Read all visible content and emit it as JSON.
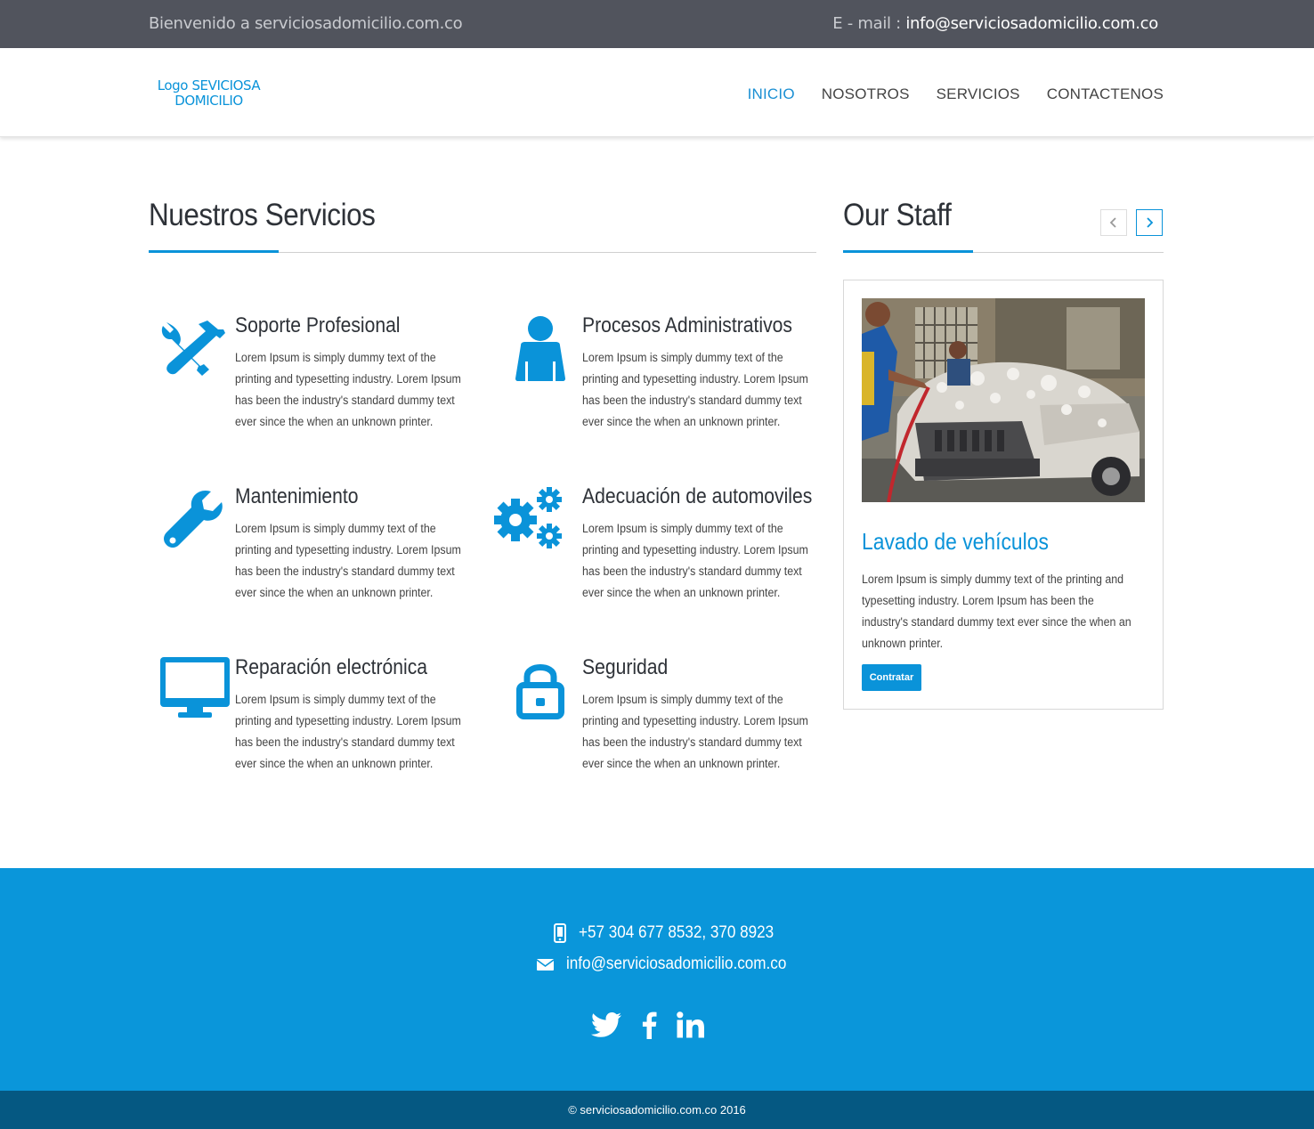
{
  "topbar": {
    "welcome": "Bienvenido a serviciosadomicilio.com.co",
    "email_label": "E - mail : ",
    "email": "info@serviciosadomicilio.com.co"
  },
  "header": {
    "logo_line1": "Logo SEVICIOSA",
    "logo_line2": "DOMICILIO",
    "nav": [
      "INICIO",
      "NOSOTROS",
      "SERVICIOS",
      "CONTACTENOS"
    ],
    "active_nav": "INICIO"
  },
  "services": {
    "title": "Nuestros Servicios",
    "items": [
      {
        "title": "Soporte Profesional",
        "icon": "tools-icon",
        "text": "Lorem Ipsum is simply dummy text of the printing and typesetting industry. Lorem Ipsum has been the industry's standard dummy text ever since the when an unknown printer."
      },
      {
        "title": "Procesos Administrativos",
        "icon": "user-icon",
        "text": "Lorem Ipsum is simply dummy text of the printing and typesetting industry. Lorem Ipsum has been the industry's standard dummy text ever since the when an unknown printer."
      },
      {
        "title": "Mantenimiento",
        "icon": "wrench-icon",
        "text": "Lorem Ipsum is simply dummy text of the printing and typesetting industry. Lorem Ipsum has been the industry's standard dummy text ever since the when an unknown printer."
      },
      {
        "title": "Adecuación de automoviles",
        "icon": "gears-icon",
        "text": "Lorem Ipsum is simply dummy text of the printing and typesetting industry. Lorem Ipsum has been the industry's standard dummy text ever since the when an unknown printer."
      },
      {
        "title": "Reparación electrónica",
        "icon": "monitor-icon",
        "text": "Lorem Ipsum is simply dummy text of the printing and typesetting industry. Lorem Ipsum has been the industry's standard dummy text ever since the when an unknown printer."
      },
      {
        "title": "Seguridad",
        "icon": "lock-icon",
        "text": "Lorem Ipsum is simply dummy text of the printing and typesetting industry. Lorem Ipsum has been the industry's standard dummy text ever since the when an unknown printer."
      }
    ]
  },
  "staff": {
    "title": "Our Staff",
    "prev_icon": "chevron-left-icon",
    "next_icon": "chevron-right-icon",
    "card": {
      "image": "car-wash-photo",
      "title": "Lavado de vehículos",
      "text": "Lorem Ipsum is simply dummy text of the printing and typesetting industry. Lorem Ipsum has been the industry's standard dummy text ever since the when an unknown printer.",
      "button": "Contratar"
    }
  },
  "footer": {
    "phone": "+57 304 677 8532, 370 8923",
    "email": "info@serviciosadomicilio.com.co",
    "social": [
      "twitter-icon",
      "facebook-icon",
      "linkedin-icon"
    ],
    "copyright": "© serviciosadomicilio.com.co 2016"
  },
  "colors": {
    "accent": "#0a93d9",
    "topbar": "#51545d",
    "footer": "#0a96da",
    "bottom_bar": "#055882"
  }
}
